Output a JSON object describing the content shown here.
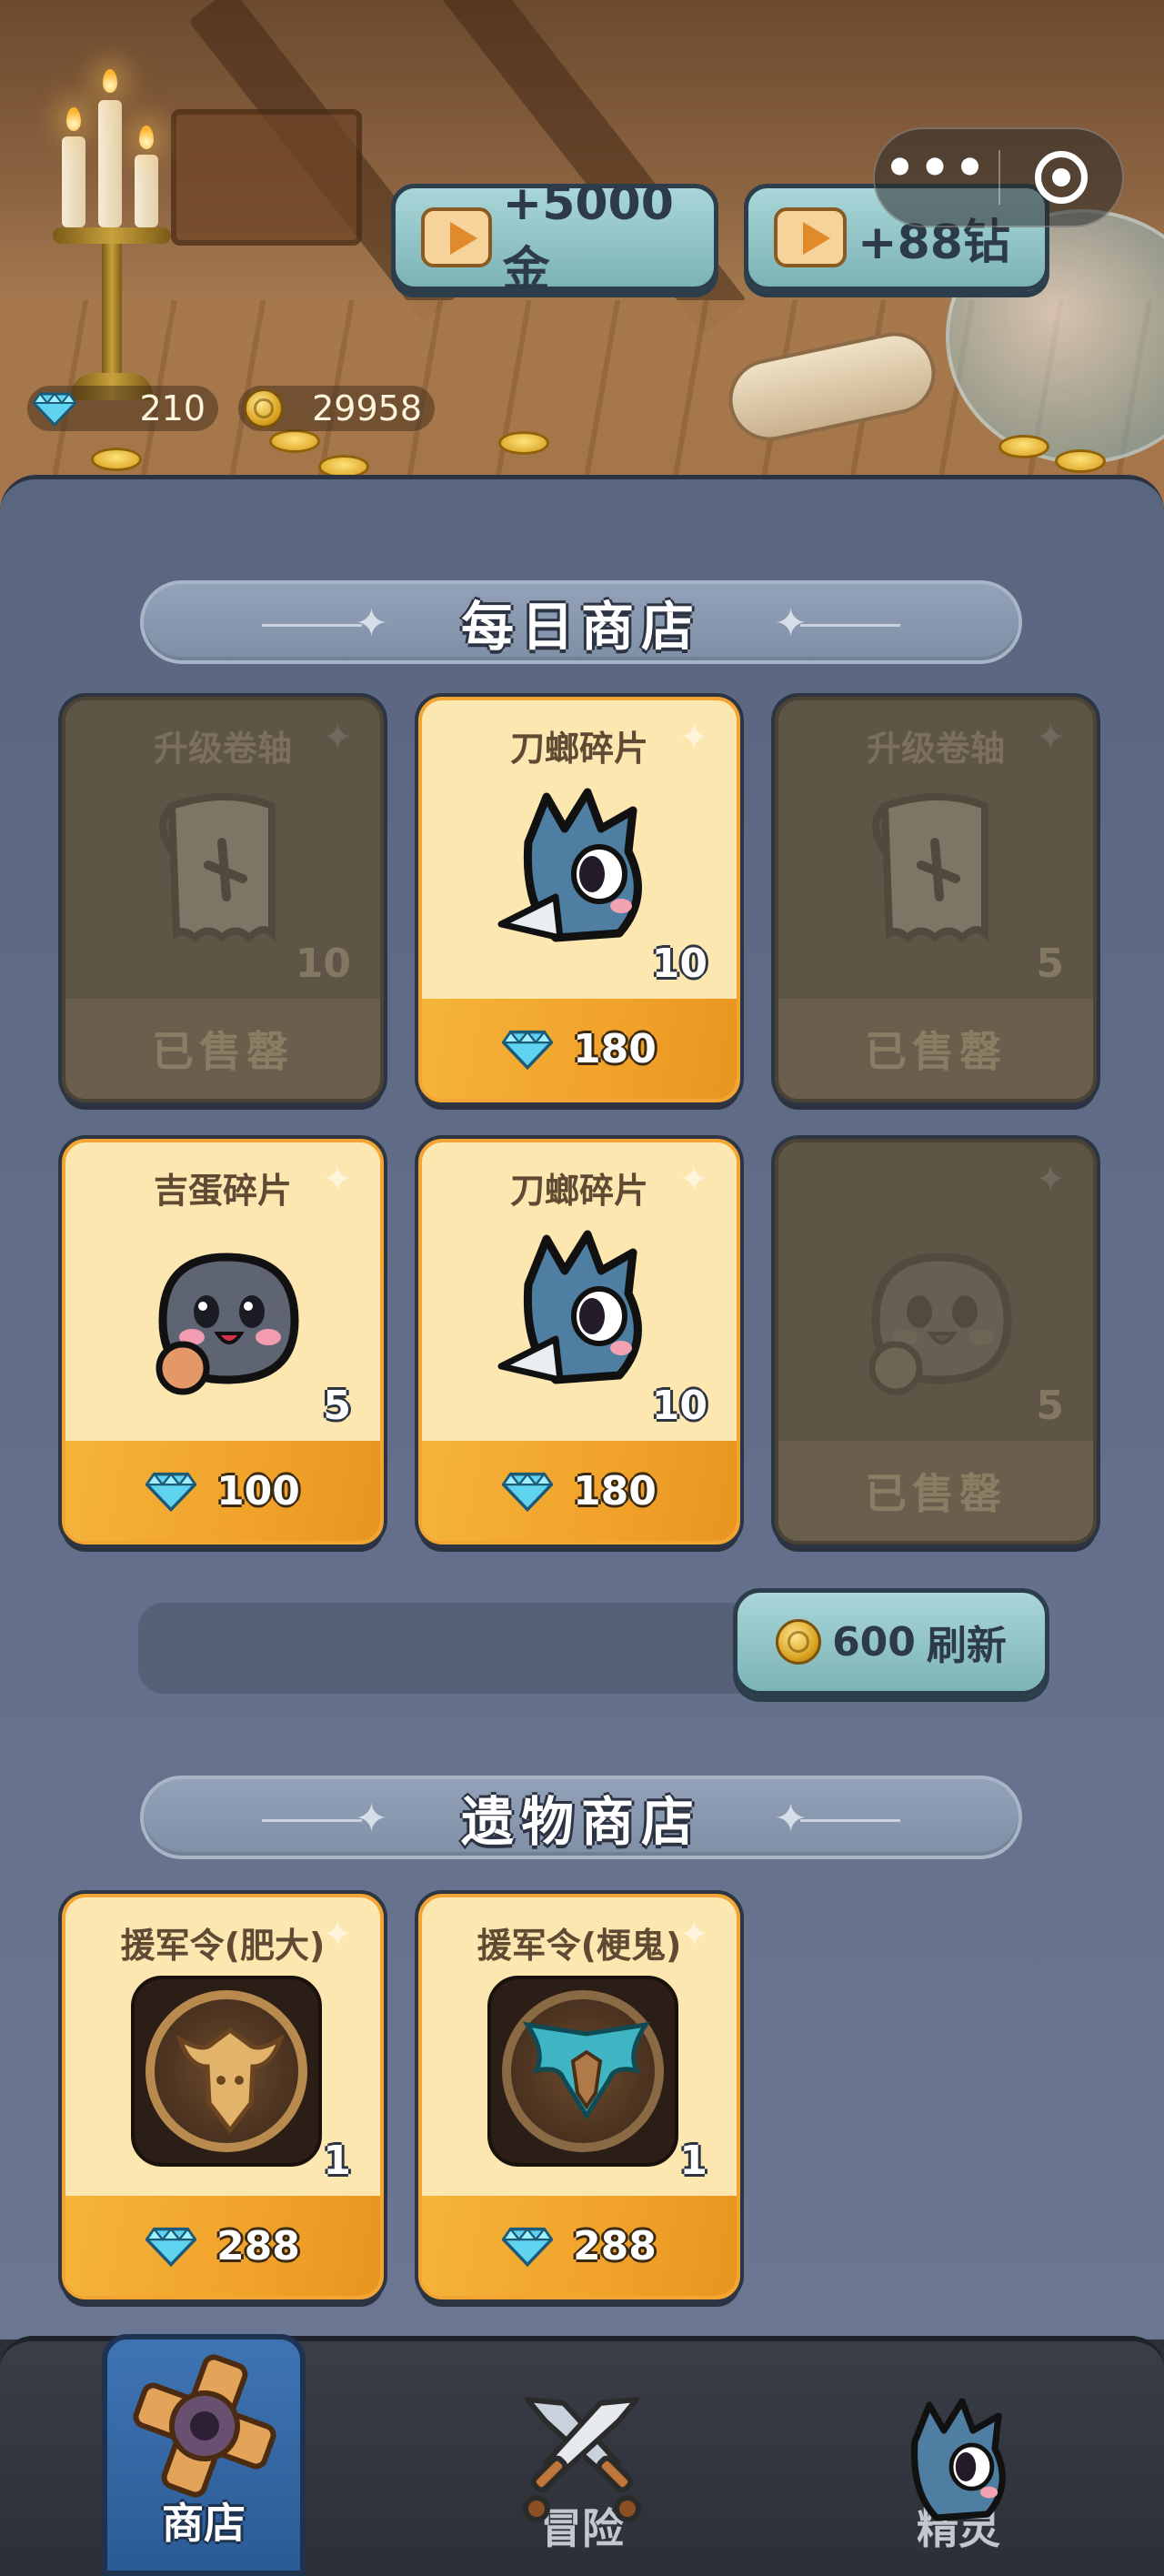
{
  "header": {
    "video_buttons": [
      {
        "label": "+5000金",
        "icon": "video-ad-icon"
      },
      {
        "label": "+88钻",
        "icon": "video-ad-icon"
      }
    ],
    "capsule": {
      "more": "•••",
      "close_icon": "close-circle-icon"
    },
    "currency": {
      "diamonds": "210",
      "gold": "29958"
    }
  },
  "daily_shop": {
    "title": "每日商店",
    "items": [
      {
        "name": "升级卷轴",
        "qty": "10",
        "status": "已售罄",
        "sold_out": true,
        "icon": "scroll-icon"
      },
      {
        "name": "刀螂碎片",
        "qty": "10",
        "price": "180",
        "sold_out": false,
        "icon": "blue-creature-icon"
      },
      {
        "name": "升级卷轴",
        "qty": "5",
        "status": "已售罄",
        "sold_out": true,
        "icon": "scroll-icon"
      },
      {
        "name": "吉蛋碎片",
        "qty": "5",
        "price": "100",
        "sold_out": false,
        "icon": "gray-blob-creature-icon"
      },
      {
        "name": "刀螂碎片",
        "qty": "10",
        "price": "180",
        "sold_out": false,
        "icon": "blue-creature-icon"
      },
      {
        "name": "",
        "qty": "5",
        "status": "已售罄",
        "sold_out": true,
        "icon": "gray-blob-creature-icon"
      }
    ],
    "refresh": {
      "cost": "600",
      "label": "刷新"
    }
  },
  "relic_shop": {
    "title": "遗物商店",
    "items": [
      {
        "name": "援军令(肥大)",
        "qty": "1",
        "price": "288",
        "icon": "gold-bull-emblem-icon"
      },
      {
        "name": "援军令(梗鬼)",
        "qty": "1",
        "price": "288",
        "icon": "teal-winged-emblem-icon"
      }
    ]
  },
  "nav": {
    "items": [
      {
        "label": "商店",
        "icon": "shop-cross-icon",
        "active": true
      },
      {
        "label": "冒险",
        "icon": "crossed-swords-icon",
        "active": false
      },
      {
        "label": "精灵",
        "icon": "blue-creature-icon",
        "active": false
      }
    ]
  },
  "colors": {
    "panel": "#636f8a",
    "card_available": "#fde7b1",
    "price_bar": "#f1a22a",
    "card_sold": "#5d5546",
    "button_teal": "#7cb3b7",
    "nav_active": "#3f74b3"
  }
}
